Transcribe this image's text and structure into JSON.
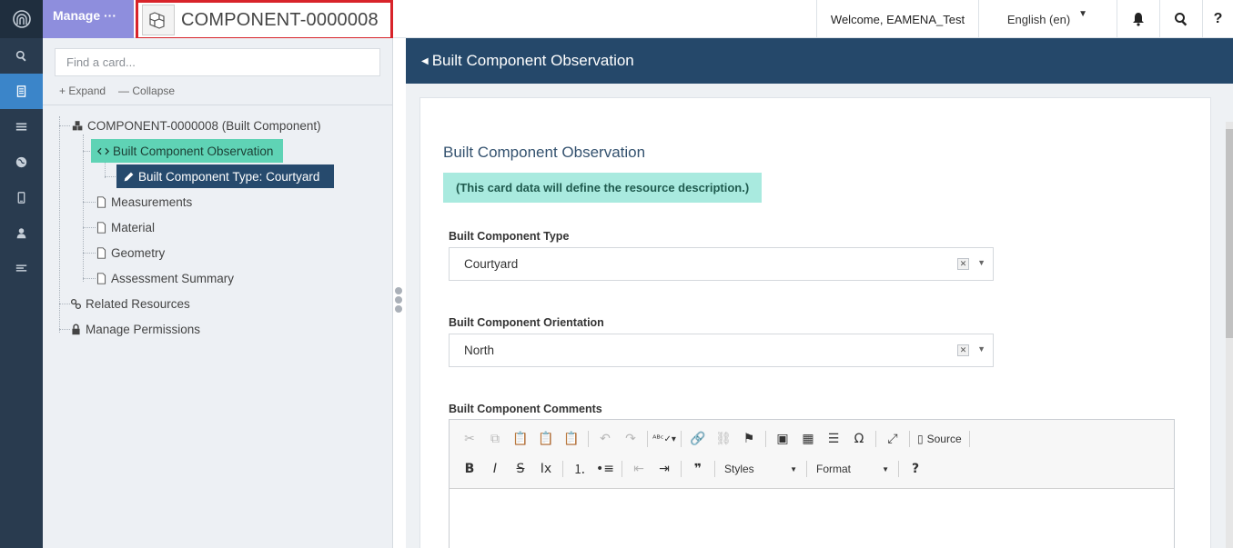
{
  "rail": {
    "items": [
      {
        "name": "search-icon"
      },
      {
        "name": "resource-icon",
        "active": true
      },
      {
        "name": "list-icon"
      },
      {
        "name": "globe-icon"
      },
      {
        "name": "mobile-icon"
      },
      {
        "name": "user-icon"
      },
      {
        "name": "menu-icon"
      }
    ]
  },
  "header": {
    "manage_label": "Manage ···",
    "resource_title": "COMPONENT-0000008",
    "welcome": "Welcome, EAMENA_Test",
    "language": "English (en)",
    "help": "?"
  },
  "tree_panel": {
    "search_placeholder": "Find a card...",
    "expand_label": "+ Expand",
    "collapse_label": "— Collapse",
    "nodes": {
      "root": "COMPONENT-0000008 (Built Component)",
      "observation": "Built Component Observation",
      "type": "Built Component Type: Courtyard",
      "measurements": "Measurements",
      "material": "Material",
      "geometry": "Geometry",
      "assessment": "Assessment Summary",
      "related": "Related Resources",
      "permissions": "Manage Permissions"
    }
  },
  "main": {
    "card_header": "Built Component Observation",
    "card_title": "Built Component Observation",
    "card_description": "(This card data will define the resource description.)",
    "fields": {
      "type_label": "Built Component Type",
      "type_value": "Courtyard",
      "orientation_label": "Built Component Orientation",
      "orientation_value": "North",
      "comments_label": "Built Component Comments"
    },
    "editor": {
      "source_label": "Source",
      "styles_label": "Styles",
      "format_label": "Format"
    }
  },
  "colors": {
    "rail": "#293b4f",
    "manage": "#8e8edd",
    "card_header": "#25486a",
    "tree_selected_obs": "#5fd3b5",
    "tree_selected_type": "#264a6d",
    "highlight_box": "#d8232a"
  }
}
